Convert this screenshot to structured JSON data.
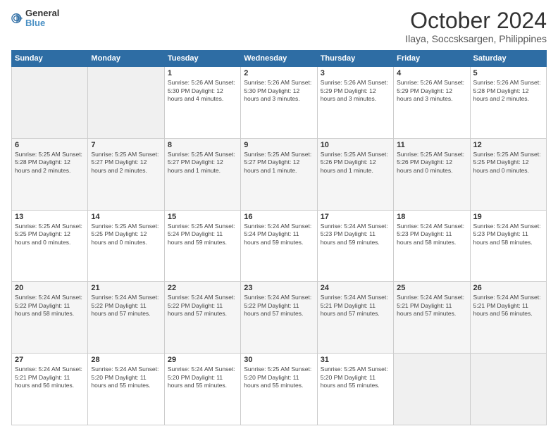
{
  "logo": {
    "line1": "General",
    "line2": "Blue"
  },
  "title": "October 2024",
  "subtitle": "Ilaya, Soccsksargen, Philippines",
  "weekdays": [
    "Sunday",
    "Monday",
    "Tuesday",
    "Wednesday",
    "Thursday",
    "Friday",
    "Saturday"
  ],
  "weeks": [
    [
      {
        "day": "",
        "info": ""
      },
      {
        "day": "",
        "info": ""
      },
      {
        "day": "1",
        "info": "Sunrise: 5:26 AM\nSunset: 5:30 PM\nDaylight: 12 hours and 4 minutes."
      },
      {
        "day": "2",
        "info": "Sunrise: 5:26 AM\nSunset: 5:30 PM\nDaylight: 12 hours and 3 minutes."
      },
      {
        "day": "3",
        "info": "Sunrise: 5:26 AM\nSunset: 5:29 PM\nDaylight: 12 hours and 3 minutes."
      },
      {
        "day": "4",
        "info": "Sunrise: 5:26 AM\nSunset: 5:29 PM\nDaylight: 12 hours and 3 minutes."
      },
      {
        "day": "5",
        "info": "Sunrise: 5:26 AM\nSunset: 5:28 PM\nDaylight: 12 hours and 2 minutes."
      }
    ],
    [
      {
        "day": "6",
        "info": "Sunrise: 5:25 AM\nSunset: 5:28 PM\nDaylight: 12 hours and 2 minutes."
      },
      {
        "day": "7",
        "info": "Sunrise: 5:25 AM\nSunset: 5:27 PM\nDaylight: 12 hours and 2 minutes."
      },
      {
        "day": "8",
        "info": "Sunrise: 5:25 AM\nSunset: 5:27 PM\nDaylight: 12 hours and 1 minute."
      },
      {
        "day": "9",
        "info": "Sunrise: 5:25 AM\nSunset: 5:27 PM\nDaylight: 12 hours and 1 minute."
      },
      {
        "day": "10",
        "info": "Sunrise: 5:25 AM\nSunset: 5:26 PM\nDaylight: 12 hours and 1 minute."
      },
      {
        "day": "11",
        "info": "Sunrise: 5:25 AM\nSunset: 5:26 PM\nDaylight: 12 hours and 0 minutes."
      },
      {
        "day": "12",
        "info": "Sunrise: 5:25 AM\nSunset: 5:25 PM\nDaylight: 12 hours and 0 minutes."
      }
    ],
    [
      {
        "day": "13",
        "info": "Sunrise: 5:25 AM\nSunset: 5:25 PM\nDaylight: 12 hours and 0 minutes."
      },
      {
        "day": "14",
        "info": "Sunrise: 5:25 AM\nSunset: 5:25 PM\nDaylight: 12 hours and 0 minutes."
      },
      {
        "day": "15",
        "info": "Sunrise: 5:25 AM\nSunset: 5:24 PM\nDaylight: 11 hours and 59 minutes."
      },
      {
        "day": "16",
        "info": "Sunrise: 5:24 AM\nSunset: 5:24 PM\nDaylight: 11 hours and 59 minutes."
      },
      {
        "day": "17",
        "info": "Sunrise: 5:24 AM\nSunset: 5:23 PM\nDaylight: 11 hours and 59 minutes."
      },
      {
        "day": "18",
        "info": "Sunrise: 5:24 AM\nSunset: 5:23 PM\nDaylight: 11 hours and 58 minutes."
      },
      {
        "day": "19",
        "info": "Sunrise: 5:24 AM\nSunset: 5:23 PM\nDaylight: 11 hours and 58 minutes."
      }
    ],
    [
      {
        "day": "20",
        "info": "Sunrise: 5:24 AM\nSunset: 5:22 PM\nDaylight: 11 hours and 58 minutes."
      },
      {
        "day": "21",
        "info": "Sunrise: 5:24 AM\nSunset: 5:22 PM\nDaylight: 11 hours and 57 minutes."
      },
      {
        "day": "22",
        "info": "Sunrise: 5:24 AM\nSunset: 5:22 PM\nDaylight: 11 hours and 57 minutes."
      },
      {
        "day": "23",
        "info": "Sunrise: 5:24 AM\nSunset: 5:22 PM\nDaylight: 11 hours and 57 minutes."
      },
      {
        "day": "24",
        "info": "Sunrise: 5:24 AM\nSunset: 5:21 PM\nDaylight: 11 hours and 57 minutes."
      },
      {
        "day": "25",
        "info": "Sunrise: 5:24 AM\nSunset: 5:21 PM\nDaylight: 11 hours and 57 minutes."
      },
      {
        "day": "26",
        "info": "Sunrise: 5:24 AM\nSunset: 5:21 PM\nDaylight: 11 hours and 56 minutes."
      }
    ],
    [
      {
        "day": "27",
        "info": "Sunrise: 5:24 AM\nSunset: 5:21 PM\nDaylight: 11 hours and 56 minutes."
      },
      {
        "day": "28",
        "info": "Sunrise: 5:24 AM\nSunset: 5:20 PM\nDaylight: 11 hours and 55 minutes."
      },
      {
        "day": "29",
        "info": "Sunrise: 5:24 AM\nSunset: 5:20 PM\nDaylight: 11 hours and 55 minutes."
      },
      {
        "day": "30",
        "info": "Sunrise: 5:25 AM\nSunset: 5:20 PM\nDaylight: 11 hours and 55 minutes."
      },
      {
        "day": "31",
        "info": "Sunrise: 5:25 AM\nSunset: 5:20 PM\nDaylight: 11 hours and 55 minutes."
      },
      {
        "day": "",
        "info": ""
      },
      {
        "day": "",
        "info": ""
      }
    ]
  ]
}
